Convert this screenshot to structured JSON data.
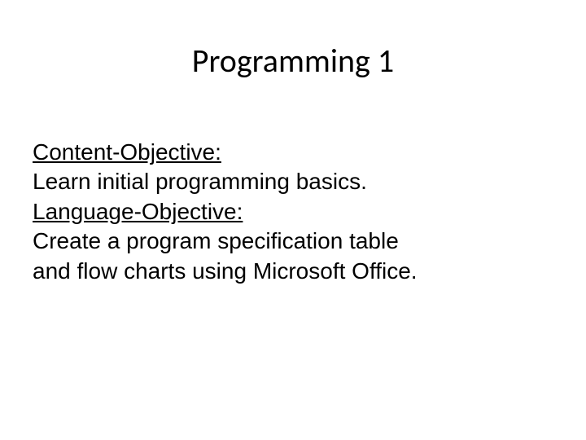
{
  "title": "Programming 1",
  "content_objective_label": "Content-Objective:",
  "content_objective_text": " Learn initial programming basics.",
  "language_objective_label": "Language-Objective:",
  "language_objective_text_line1": " Create a program specification table",
  "language_objective_text_line2": "and flow charts using Microsoft Office."
}
